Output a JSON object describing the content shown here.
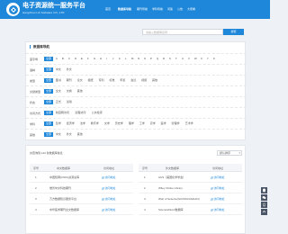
{
  "header": {
    "title": "电子资源统一服务平台",
    "subtitle": "Hangzhou Lib Software CO.,LTD",
    "nav": [
      {
        "label": "首页",
        "active": false
      },
      {
        "label": "数据库导航",
        "active": true
      },
      {
        "label": "期刊导航",
        "active": false
      },
      {
        "label": "学科导航",
        "active": false
      },
      {
        "label": "问答",
        "active": false
      },
      {
        "label": "公告",
        "active": false
      },
      {
        "label": "大家看",
        "active": false
      }
    ]
  },
  "search": {
    "placeholder": "请输入数据库名称",
    "button_label": "搜索"
  },
  "filters": {
    "title": "数据库导航",
    "rows": [
      {
        "label": "首字母",
        "options": [
          "全部",
          "A",
          "B",
          "C",
          "D",
          "E",
          "F",
          "G",
          "H",
          "I",
          "J",
          "K",
          "L",
          "M",
          "N",
          "O",
          "P",
          "Q",
          "R",
          "S",
          "T",
          "U",
          "V",
          "W",
          "X",
          "Y",
          "Z"
        ],
        "selected": 0
      },
      {
        "label": "语种",
        "options": [
          "全部",
          "中文",
          "外文"
        ],
        "selected": 0
      },
      {
        "label": "类型",
        "options": [
          "全部",
          "图书",
          "期刊",
          "论文",
          "报纸",
          "专利",
          "标准",
          "年鉴",
          "会议",
          "视频",
          "其他"
        ],
        "selected": 0
      },
      {
        "label": "文献类型",
        "options": [
          "全部",
          "全文",
          "文摘",
          "其他"
        ],
        "selected": 0
      },
      {
        "label": "状态",
        "options": [
          "全部",
          "正式",
          "试用"
        ],
        "selected": 0
      },
      {
        "label": "访问方式",
        "options": [
          "全部",
          "校园网访问",
          "远程访问",
          "公共检索"
        ],
        "selected": 0
      },
      {
        "label": "学科",
        "options": [
          "全部",
          "哲学",
          "经济学",
          "法学",
          "教育学",
          "文学",
          "历史学",
          "理学",
          "工学",
          "农学",
          "医学",
          "管理学",
          "艺术学"
        ],
        "selected": 0
      },
      {
        "label": "其他",
        "options": [
          "全部",
          "中文",
          "外文",
          "其他"
        ],
        "selected": 0
      }
    ]
  },
  "results": {
    "count_text": "共查询到 143 条数据库信息",
    "sort_label": "默认排序",
    "columns": [
      "序号",
      "中文数据库",
      "访问地址"
    ],
    "left_rows": [
      {
        "no": "1",
        "name": "中国知网(CNKI)资源总库",
        "link": "访问地址"
      },
      {
        "no": "2",
        "name": "维普中文科技期刊",
        "link": "访问地址"
      },
      {
        "no": "3",
        "name": "万方数据知识服务平台",
        "link": "访问地址"
      },
      {
        "no": "4",
        "name": "中华医学期刊全文数据库",
        "link": "访问地址"
      }
    ],
    "right_columns": [
      "序号",
      "外文数据库",
      "访问地址"
    ],
    "right_rows": [
      {
        "no": "1",
        "name": "ACS（美国化学学会）",
        "link": "访问地址"
      },
      {
        "no": "2",
        "name": "Wiley Online Library",
        "link": "访问地址"
      },
      {
        "no": "3",
        "name": "Web of Science(SCI/SSCI/A&HCI)",
        "link": "访问地址"
      },
      {
        "no": "4",
        "name": "ScienceDirect数据库",
        "link": "访问地址"
      }
    ]
  },
  "colors": {
    "primary": "#1e87d9",
    "background": "#eef1f5",
    "side_tool": "#4a5566"
  },
  "side_tools": [
    "qq-icon",
    "wechat-icon",
    "phone-icon",
    "back-to-top-icon"
  ]
}
